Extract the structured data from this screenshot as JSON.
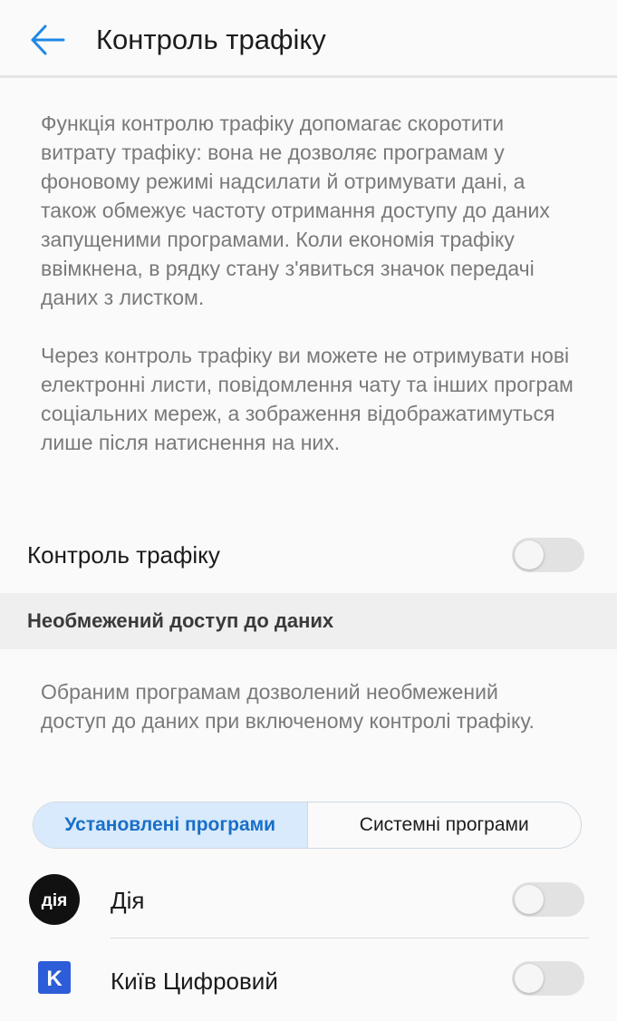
{
  "header": {
    "title": "Контроль трафіку"
  },
  "intro": {
    "paragraph1": "Функція контролю трафіку допомагає скоротити витрату трафіку: вона не дозволяє програмам у фоновому режимі надсилати й отримувати дані, а також обмежує частоту отримання доступу до даних запущеними програмами. Коли економія трафіку ввімкнена, в рядку стану з'явиться значок передачі даних з листком.",
    "paragraph2": "Через контроль трафіку ви можете не отримувати нові електронні листи, повідомлення чату та інших програм соціальних мереж, а зображення відображатимуться лише після натиснення на них."
  },
  "traffic_control": {
    "label": "Контроль трафіку",
    "enabled": false
  },
  "unrestricted": {
    "section_title": "Необмежений доступ до даних",
    "description": "Обраним програмам дозволений необмежений доступ до даних при включеному контролі трафіку."
  },
  "tabs": [
    {
      "label": "Установлені програми",
      "active": true
    },
    {
      "label": "Системні програми",
      "active": false
    }
  ],
  "apps": [
    {
      "name": "Дія",
      "icon_text": "дія",
      "enabled": false
    },
    {
      "name": "Київ Цифровий",
      "icon_text": "K",
      "enabled": false
    }
  ],
  "colors": {
    "accent": "#1a6fc7",
    "back_arrow": "#1e88e5",
    "tab_active_bg": "#d8eafb",
    "toggle_off": "#e2e2e2",
    "kyiv_blue": "#2d5cd8"
  }
}
